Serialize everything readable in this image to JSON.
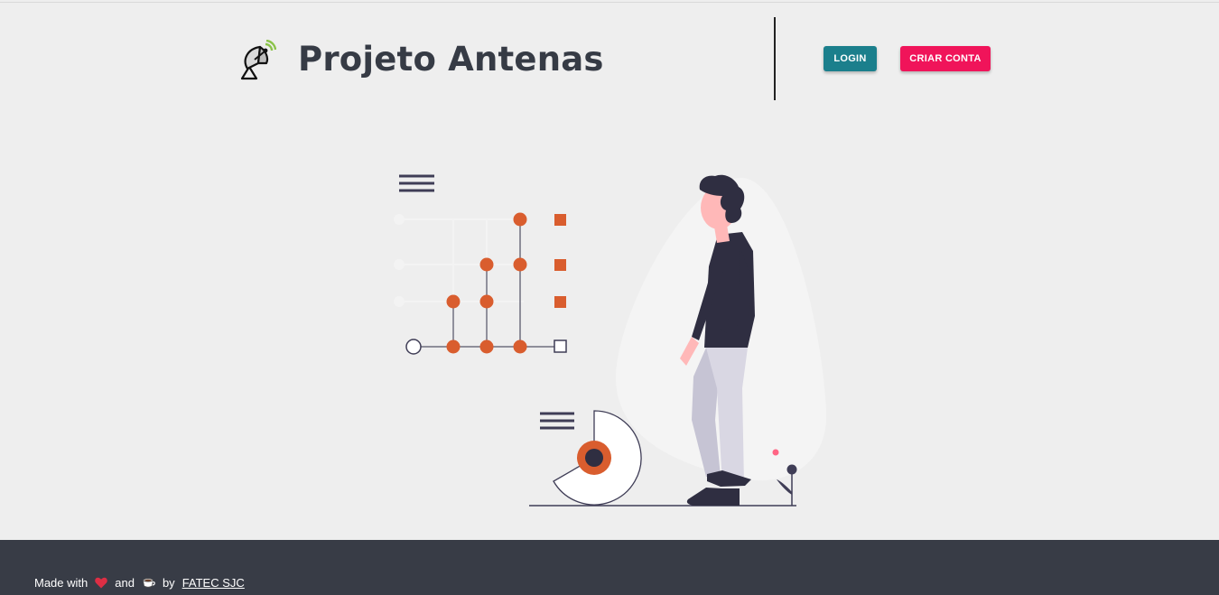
{
  "header": {
    "logo_icon": "satellite-antenna-icon",
    "brand_title": "Projeto Antenas",
    "login_label": "LOGIN",
    "create_account_label": "CRIAR CONTA"
  },
  "colors": {
    "login_button": "#1b7f8c",
    "create_account_button": "#f0145a",
    "footer_background": "#383c46",
    "illustration_accent": "#d95d2e"
  },
  "hero": {
    "illustration_icon": "person-walking-with-data-charts-illustration"
  },
  "footer": {
    "made_with": "Made with",
    "heart_icon": "heart-icon",
    "and": "and",
    "coffee_icon": "coffee-icon",
    "by": "by",
    "link_label": "FATEC SJC"
  }
}
